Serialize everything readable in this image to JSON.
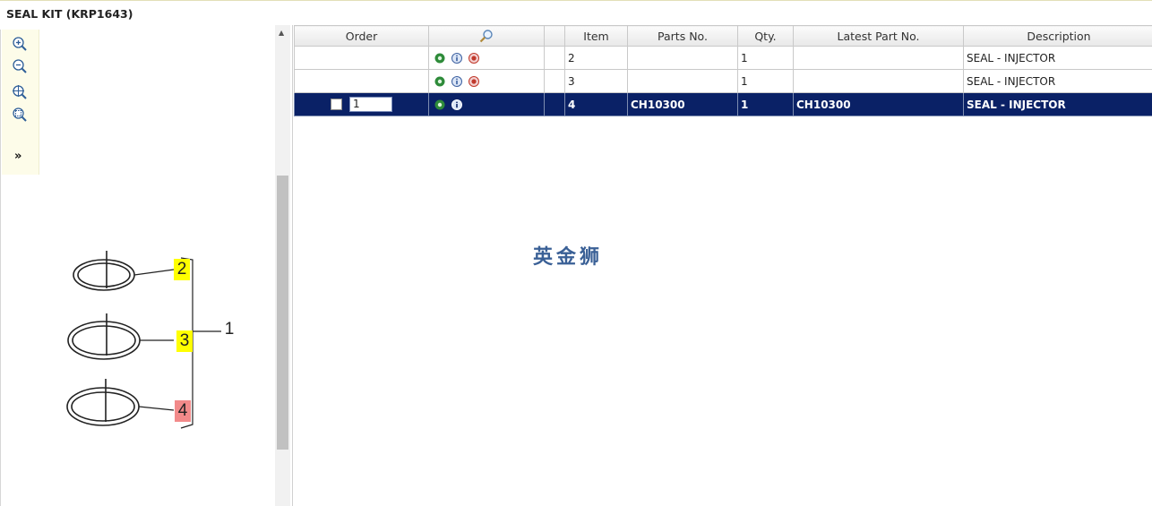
{
  "page": {
    "title": "SEAL KIT (KRP1643)"
  },
  "toolbar": {
    "expand_label": "»"
  },
  "illustration": {
    "callouts": [
      {
        "label": "2",
        "highlight": "yellow"
      },
      {
        "label": "3",
        "highlight": "yellow"
      },
      {
        "label": "1",
        "highlight": "none"
      },
      {
        "label": "4",
        "highlight": "red"
      }
    ]
  },
  "grid": {
    "columns": [
      "Order",
      "",
      "",
      "Item",
      "Parts No.",
      "Qty.",
      "Latest Part No.",
      "Description"
    ],
    "rows": [
      {
        "order": "",
        "item": "2",
        "parts_no": "",
        "qty": "1",
        "latest_part_no": "",
        "description": "SEAL - INJECTOR",
        "selected": false
      },
      {
        "order": "",
        "item": "3",
        "parts_no": "",
        "qty": "1",
        "latest_part_no": "",
        "description": "SEAL - INJECTOR",
        "selected": false
      },
      {
        "order": "1",
        "item": "4",
        "parts_no": "CH10300",
        "qty": "1",
        "latest_part_no": "CH10300",
        "description": "SEAL - INJECTOR",
        "selected": true
      }
    ]
  },
  "watermark": "英金狮",
  "colors": {
    "selected_row": "#0a2166",
    "callout_yellow": "#ffff00",
    "callout_red": "#f28a8a",
    "toolbar_bg": "#fdfce9"
  }
}
